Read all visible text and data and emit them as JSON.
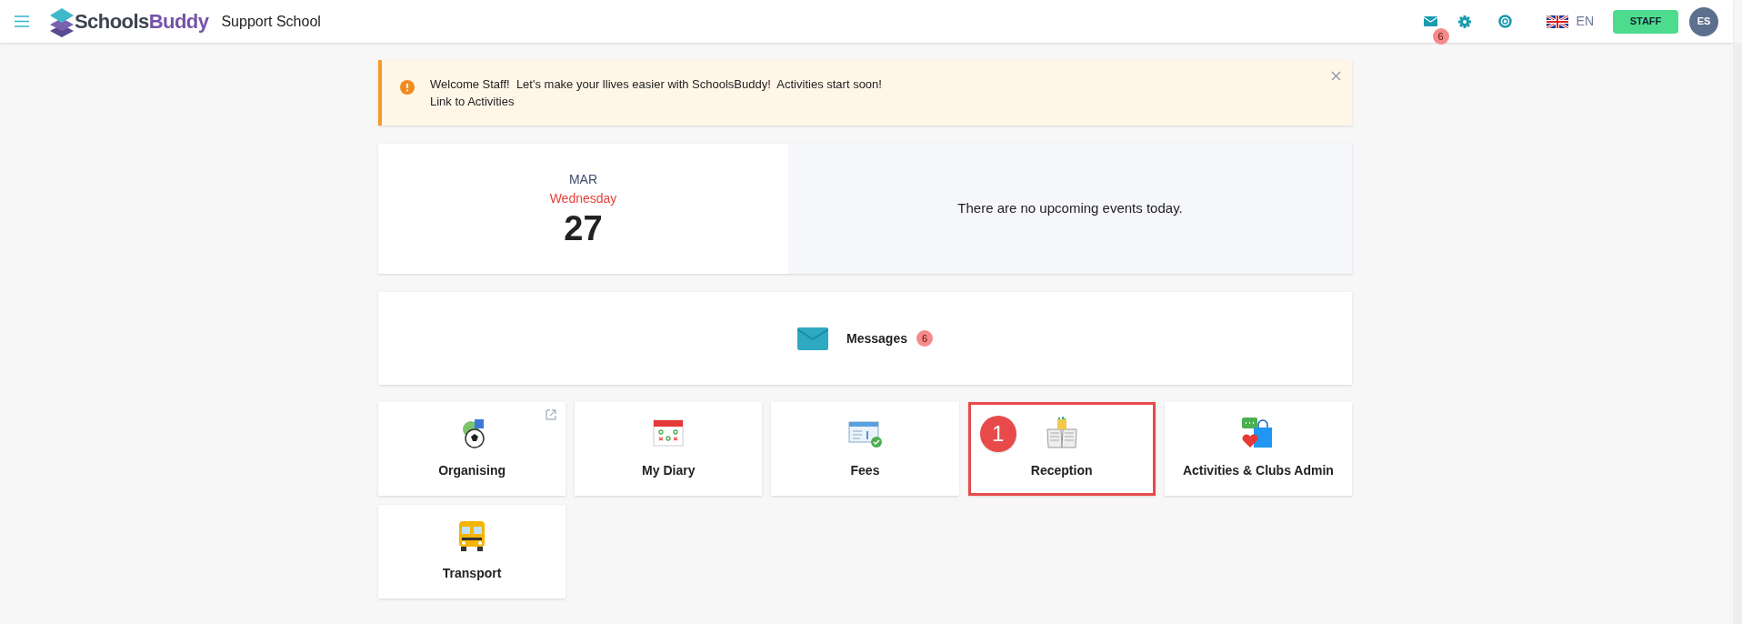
{
  "header": {
    "brand": {
      "first": "Schools",
      "second": "Buddy"
    },
    "school": "Support School",
    "mail_count": "6",
    "language": "EN",
    "role_button": "STAFF",
    "avatar": "ES"
  },
  "alert": {
    "message": "Welcome Staff!  Let's make your llives easier with SchoolsBuddy!  Activities start soon!",
    "link": "Link to Activities"
  },
  "date_card": {
    "month": "MAR",
    "weekday": "Wednesday",
    "day": "27",
    "events_text": "There are no upcoming events today."
  },
  "messages_card": {
    "label": "Messages",
    "count": "6"
  },
  "tiles": [
    {
      "kind": "organising",
      "label": "Organising",
      "external": true,
      "highlighted": false
    },
    {
      "kind": "diary",
      "label": "My Diary",
      "external": false,
      "highlighted": false
    },
    {
      "kind": "fees",
      "label": "Fees",
      "external": false,
      "highlighted": false
    },
    {
      "kind": "reception",
      "label": "Reception",
      "external": false,
      "highlighted": true,
      "callout": "1"
    },
    {
      "kind": "activities",
      "label": "Activities & Clubs Admin",
      "external": false,
      "highlighted": false
    },
    {
      "kind": "transport",
      "label": "Transport",
      "external": false,
      "highlighted": false
    }
  ]
}
